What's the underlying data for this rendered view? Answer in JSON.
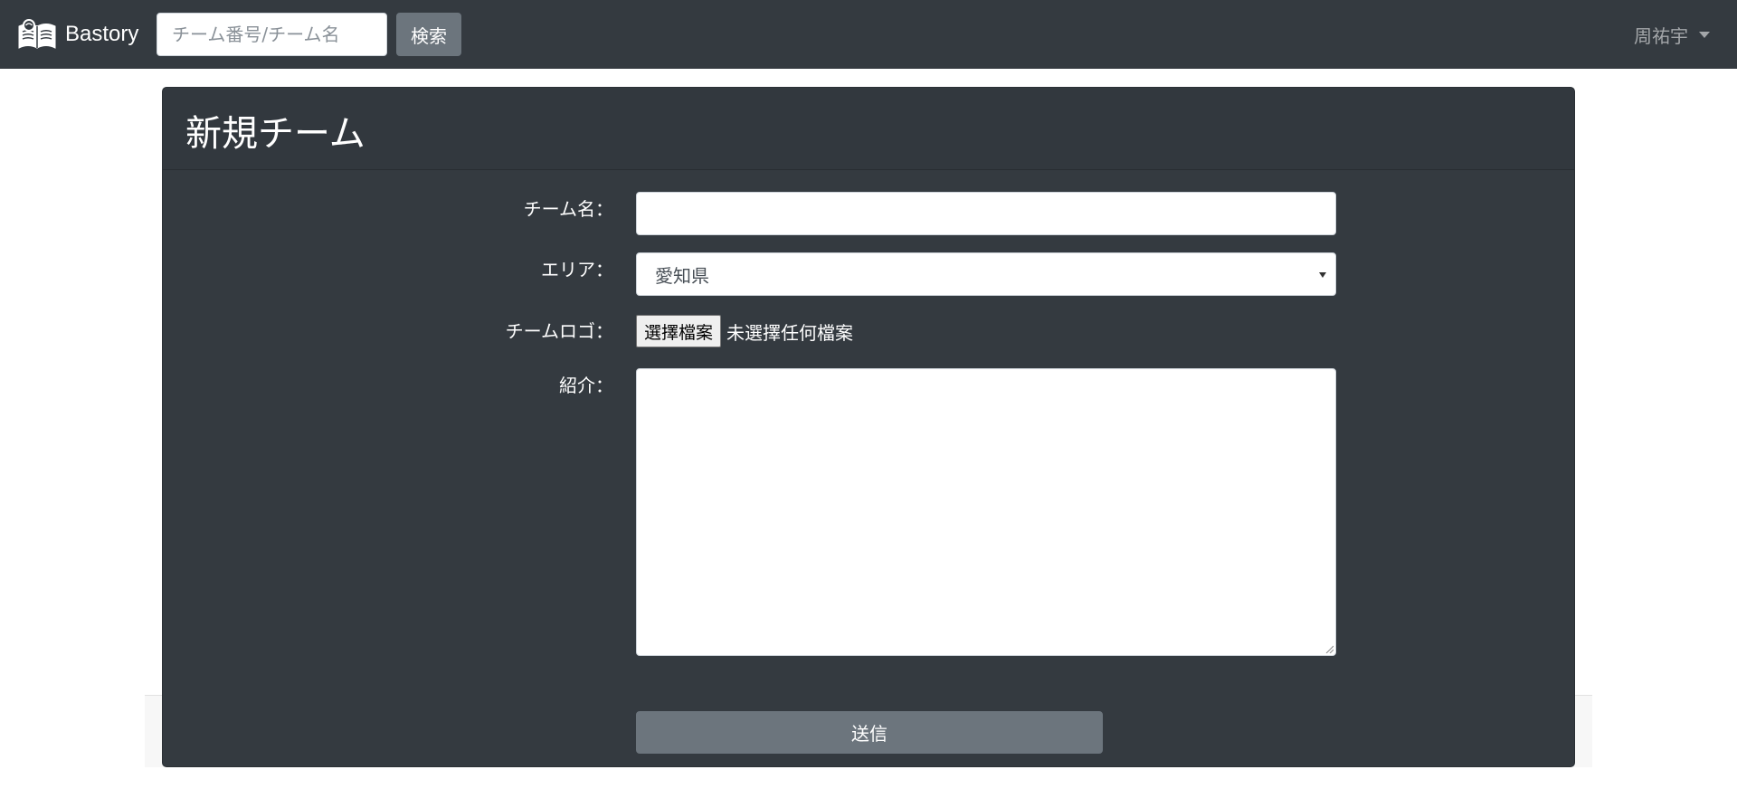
{
  "navbar": {
    "brand": "Bastory",
    "search_placeholder": "チーム番号/チーム名",
    "search_button": "検索",
    "user_name": "周祐宇"
  },
  "card": {
    "title": "新規チーム"
  },
  "form": {
    "team_name_label": "チーム名：",
    "team_name_value": "",
    "area_label": "エリア：",
    "area_value": "愛知県",
    "logo_label": "チームロゴ：",
    "logo_button": "選擇檔案",
    "logo_status": "未選擇任何檔案",
    "intro_label": "紹介：",
    "intro_value": "",
    "submit_label": "送信"
  },
  "colors": {
    "navbar_bg": "#343a40",
    "card_bg": "#343a40",
    "button_secondary": "#6c757d"
  },
  "icons": {
    "brand": "open-book-logo-icon",
    "user_menu": "caret-down-icon",
    "select": "select-arrow-icon",
    "textarea": "resize-handle-icon"
  }
}
